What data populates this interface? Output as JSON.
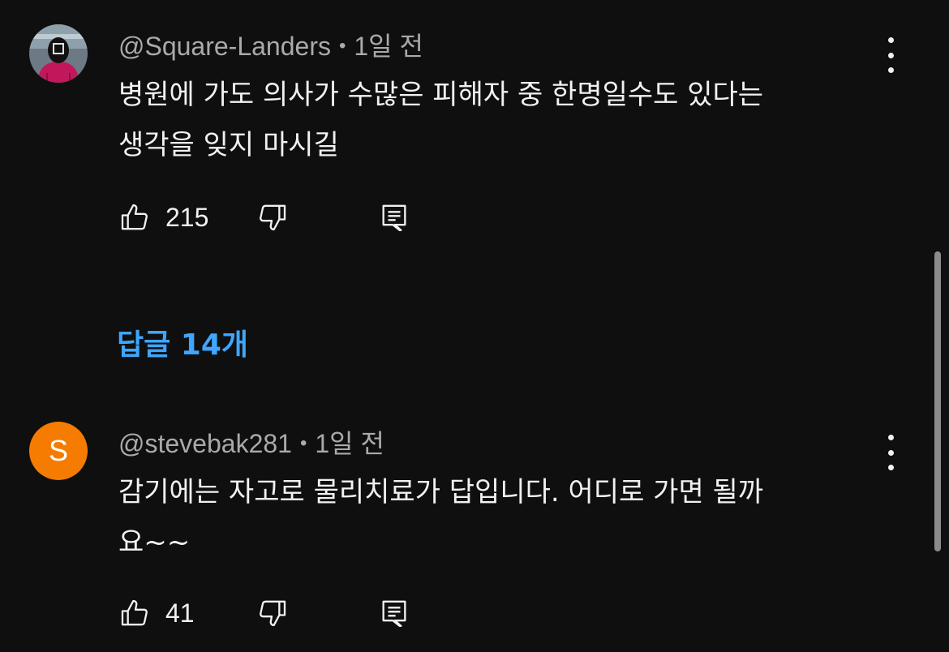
{
  "comments": [
    {
      "author": "@Square-Landers",
      "separator": "•",
      "time": "1일 전",
      "text_line1": "병원에 가도 의사가 수많은 피해자 중 한명일수도 있다는",
      "text_line2": "생각을 잊지 마시길",
      "likes": "215",
      "avatar_icon": "masked-guard-avatar"
    },
    {
      "author": "@stevebak281",
      "separator": "•",
      "time": "1일 전",
      "text_line1": "감기에는 자고로 물리치료가 답입니다. 어디로 가면 될까",
      "text_line2": "요~~",
      "likes": "41",
      "avatar_letter": "S",
      "avatar_color": "#f57c00"
    }
  ],
  "replies_label": "답글 14개",
  "colors": {
    "background": "#0f0f0f",
    "link": "#3ea6ff",
    "meta": "#aaaaaa",
    "text": "#f1f1f1"
  }
}
